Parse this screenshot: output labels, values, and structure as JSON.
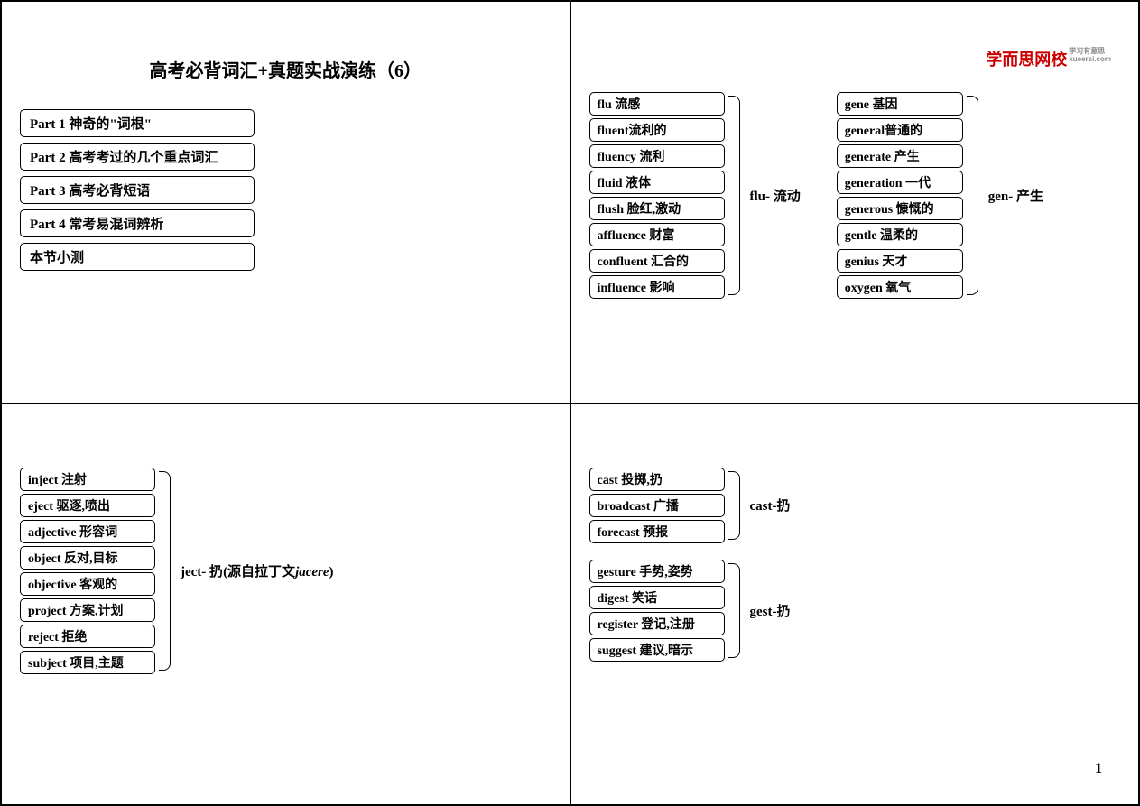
{
  "title": "高考必背词汇+真题实战演练（6）",
  "toc": [
    "Part 1 神奇的\"词根\"",
    "Part 2 高考考过的几个重点词汇",
    "Part 3 高考必背短语",
    "Part 4 常考易混词辨析",
    "本节小测"
  ],
  "logo": {
    "main": "学而思网校",
    "sub1": "学习有意思",
    "sub2": "xueersi.com"
  },
  "groups": {
    "flu": {
      "root": "flu- 流动",
      "words": [
        "flu 流感",
        "fluent流利的",
        "fluency 流利",
        "fluid 液体",
        "flush 脸红,激动",
        "affluence 财富",
        "confluent 汇合的",
        "influence 影响"
      ]
    },
    "gen": {
      "root": "gen- 产生",
      "words": [
        "gene 基因",
        "general普通的",
        "generate 产生",
        "generation 一代",
        "generous 慷慨的",
        "gentle 温柔的",
        "genius 天才",
        "oxygen 氧气"
      ]
    },
    "ject": {
      "root_en": "ject- 扔",
      "root_note": "(源自拉丁文",
      "root_it": "jacere",
      "root_end": ")",
      "words": [
        "inject 注射",
        "eject 驱逐,喷出",
        "adjective 形容词",
        "object 反对,目标",
        "objective 客观的",
        "project 方案,计划",
        "reject 拒绝",
        "subject 项目,主题"
      ]
    },
    "cast": {
      "root": "cast-扔",
      "words": [
        "cast 投掷,扔",
        "broadcast 广播",
        "forecast 预报"
      ]
    },
    "gest": {
      "root": "gest-扔",
      "words": [
        "gesture 手势,姿势",
        "digest 笑话",
        "register 登记,注册",
        "suggest 建议,暗示"
      ]
    }
  },
  "page_num": "1"
}
